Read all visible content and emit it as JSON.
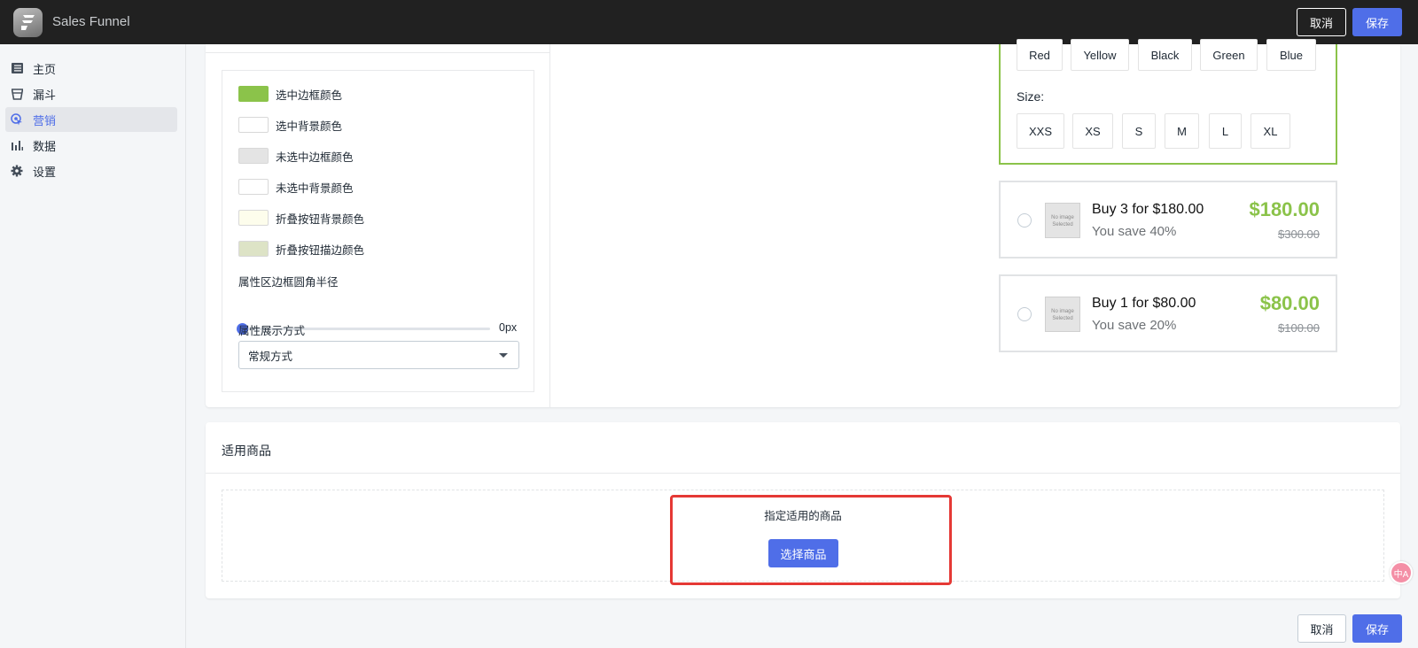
{
  "app": {
    "title": "Sales Funnel"
  },
  "topbar": {
    "cancel_label": "取消",
    "save_label": "保存"
  },
  "sidebar": {
    "items": [
      {
        "label": "主页",
        "icon": "list-icon"
      },
      {
        "label": "漏斗",
        "icon": "funnel-icon"
      },
      {
        "label": "营销",
        "icon": "marketing-icon",
        "active": true
      },
      {
        "label": "数据",
        "icon": "bar-chart-icon"
      },
      {
        "label": "设置",
        "icon": "gear-icon"
      }
    ]
  },
  "settings": {
    "colors": [
      {
        "label": "选中边框颜色",
        "color": "#8bc34a"
      },
      {
        "label": "选中背景颜色",
        "color": "#ffffff"
      },
      {
        "label": "未选中边框颜色",
        "color": "#e4e4e4"
      },
      {
        "label": "未选中背景颜色",
        "color": "#ffffff"
      },
      {
        "label": "折叠按钮背景颜色",
        "color": "#fdfdec"
      },
      {
        "label": "折叠按钮描边颜色",
        "color": "#dde3c6"
      }
    ],
    "radius_label": "属性区边框圆角半径",
    "radius_value": "0px",
    "display_label": "属性展示方式",
    "display_value": "常规方式"
  },
  "preview": {
    "colors": [
      "Red",
      "Yellow",
      "Black",
      "Green",
      "Blue"
    ],
    "size_label": "Size:",
    "sizes": [
      "XXS",
      "XS",
      "S",
      "M",
      "L",
      "XL"
    ],
    "offers": [
      {
        "title": "Buy 3 for $180.00",
        "save": "You save 40%",
        "price": "$180.00",
        "old_price": "$300.00",
        "image_text": "No image Selected"
      },
      {
        "title": "Buy 1 for $80.00",
        "save": "You save 20%",
        "price": "$80.00",
        "old_price": "$100.00",
        "image_text": "No image Selected"
      }
    ]
  },
  "products": {
    "title": "适用商品",
    "prompt": "指定适用的商品",
    "choose_label": "选择商品"
  },
  "footer": {
    "cancel_label": "取消",
    "save_label": "保存"
  },
  "float_badge": {
    "text": "中A"
  },
  "theme": {
    "accent": "#4f6ee8",
    "green": "#8bc34a",
    "highlight": "#e53935"
  }
}
